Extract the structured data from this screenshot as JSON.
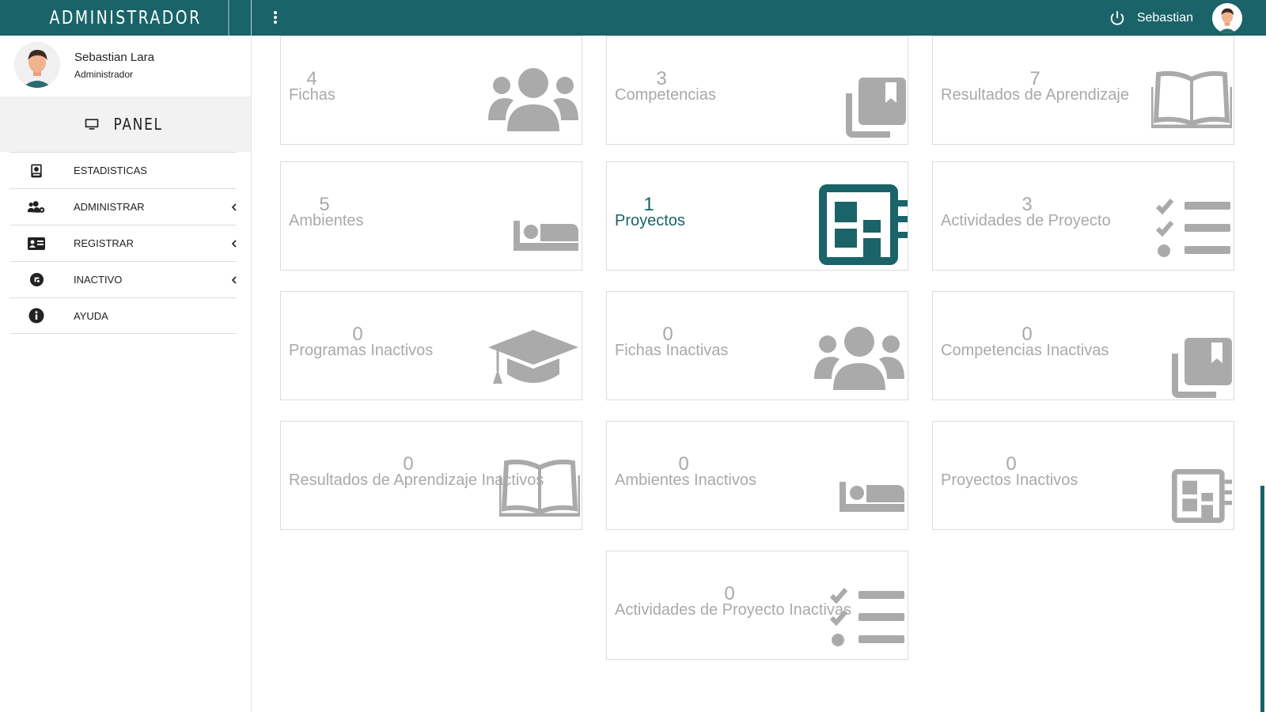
{
  "header": {
    "brand": "ADMINISTRADOR",
    "user_name": "Sebastian",
    "color": "#196369"
  },
  "sidebar": {
    "profile_name": "Sebastian Lara",
    "profile_role": "Administrador",
    "panel_label": "PANEL",
    "items": [
      {
        "label": "ESTADISTICAS",
        "icon": "chart-book-icon",
        "has_submenu": false
      },
      {
        "label": "ADMINISTRAR",
        "icon": "users-gear-icon",
        "has_submenu": true
      },
      {
        "label": "REGISTRAR",
        "icon": "id-card-icon",
        "has_submenu": true
      },
      {
        "label": "INACTIVO",
        "icon": "inactive-circle-icon",
        "has_submenu": true
      },
      {
        "label": "AYUDA",
        "icon": "info-circle-icon",
        "has_submenu": false
      }
    ]
  },
  "cards": [
    {
      "count": "4",
      "label": "Fichas",
      "icon": "users-icon"
    },
    {
      "count": "3",
      "label": "Competencias",
      "icon": "book-bookmark-icon"
    },
    {
      "count": "7",
      "label": "Resultados de Aprendizaje",
      "icon": "open-book-icon"
    },
    {
      "count": "5",
      "label": "Ambientes",
      "icon": "bed-icon"
    },
    {
      "count": "1",
      "label": "Proyectos",
      "icon": "project-board-icon",
      "active": true
    },
    {
      "count": "3",
      "label": "Actividades de Proyecto",
      "icon": "task-list-icon"
    },
    {
      "count": "0",
      "label": "Programas Inactivos",
      "icon": "graduation-cap-icon"
    },
    {
      "count": "0",
      "label": "Fichas Inactivas",
      "icon": "users-icon"
    },
    {
      "count": "0",
      "label": "Competencias Inactivas",
      "icon": "book-bookmark-icon"
    },
    {
      "count": "0",
      "label": "Resultados de Aprendizaje Inactivos",
      "icon": "open-book-icon"
    },
    {
      "count": "0",
      "label": "Ambientes Inactivos",
      "icon": "bed-icon"
    },
    {
      "count": "0",
      "label": "Proyectos Inactivos",
      "icon": "project-board-icon"
    },
    {
      "count": "0",
      "label": "Actividades de Proyecto Inactivas",
      "icon": "task-list-icon"
    }
  ]
}
